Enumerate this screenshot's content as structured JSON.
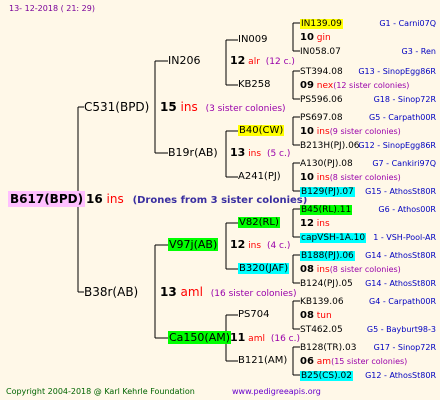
{
  "header": {
    "date": "13- 12-2018 ( 21: 29)"
  },
  "footer": {
    "copyright": "Copyright 2004-2018 @ Karl Kehrle Foundation",
    "url": "www.pedigreeapis.org"
  },
  "root": {
    "name": "B617(BPD)",
    "num": "16",
    "unit": "ins",
    "note": "(Drones from 3 sister colonies)"
  },
  "mother": {
    "name": "C531(BPD)",
    "num": "15",
    "unit": "ins",
    "note": "(3 sister colonies)"
  },
  "father": {
    "name": "B38r(AB)",
    "num": "13",
    "unit": "aml",
    "note": "(16 sister colonies)"
  },
  "gen3": [
    {
      "name": "IN206",
      "num": "12",
      "unit": "alr",
      "note": "(12 c.)"
    },
    {
      "name": "B19r(AB)",
      "num": "13",
      "unit": "ins",
      "note": "(5 c.)"
    },
    {
      "name": "V97j(AB)",
      "num": "12",
      "unit": "ins",
      "note": "(4 c.)"
    },
    {
      "name": "Ca150(AM)",
      "num": "11",
      "unit": "aml",
      "note": "(16 c.)"
    }
  ],
  "gen4": [
    {
      "name": "IN009"
    },
    {
      "name": "KB258"
    },
    {
      "name": "B40(CW)"
    },
    {
      "name": "A241(PJ)"
    },
    {
      "name": "V82(RL)"
    },
    {
      "name": "B320(JAF)"
    },
    {
      "name": "PS704"
    },
    {
      "name": "B121(AM)"
    }
  ],
  "gen5": [
    {
      "top": "IN139.09",
      "topSide": "G1 - Carni07Q",
      "num": "10",
      "unit": "gin",
      "note": "",
      "bottom": "IN058.07",
      "bottomSide": "G3 - Ren"
    },
    {
      "top": "ST394.08",
      "topSide": "G13 - SinopEgg86R",
      "num": "09",
      "unit": "nex",
      "note": "(12 sister colonies)",
      "bottom": "PS596.06",
      "bottomSide": "G18 - Sinop72R"
    },
    {
      "top": "PS697.08",
      "topSide": "G5 - Carpath00R",
      "num": "10",
      "unit": "ins",
      "note": "(9 sister colonies)",
      "bottom": "B213H(PJ).06",
      "bottomSide": "G12 - SinopEgg86R"
    },
    {
      "top": "A130(PJ).08",
      "topSide": "G7 - Cankiri97Q",
      "num": "10",
      "unit": "ins",
      "note": "(8 sister colonies)",
      "bottom": "B129(PJ).07",
      "bottomSide": "G15 - AthosSt80R"
    },
    {
      "top": "B45(RL).11",
      "topSide": "G6 - Athos00R",
      "num": "12",
      "unit": "ins",
      "note": "",
      "bottom": "capVSH-1A.10",
      "bottomSide": "1 - VSH-Pool-AR"
    },
    {
      "top": "B188(PJ).06",
      "topSide": "G14 - AthosSt80R",
      "num": "08",
      "unit": "ins",
      "note": "(8 sister colonies)",
      "bottom": "B124(PJ).05",
      "bottomSide": "G14 - AthosSt80R"
    },
    {
      "top": "KB139.06",
      "topSide": "G4 - Carpath00R",
      "num": "08",
      "unit": "tun",
      "note": "",
      "bottom": "ST462.05",
      "bottomSide": "G5 - Bayburt98-3"
    },
    {
      "top": "B128(TR).03",
      "topSide": "G17 - Sinop72R",
      "num": "06",
      "unit": "am",
      "note": "(15 sister colonies)",
      "bottom": "B25(CS).02",
      "bottomSide": "G12 - AthosSt80R"
    }
  ],
  "colors": {
    "unit": "#ff0000",
    "note": "#9900aa",
    "rootNote": "#3a2fa0",
    "side": "#0000c0",
    "line": "#000000",
    "rootBox": "#ffc0ff",
    "yellow": "#ffff00",
    "green": "#00ff00",
    "cyan": "#00ffff"
  }
}
